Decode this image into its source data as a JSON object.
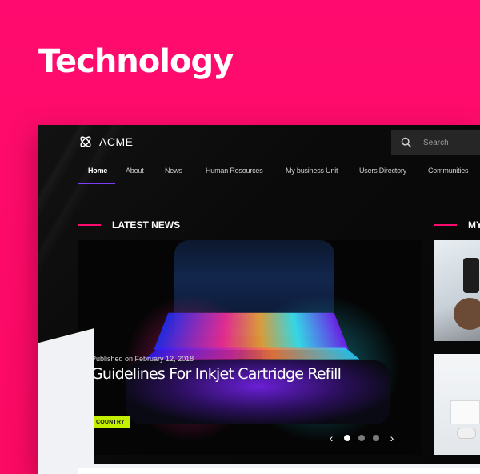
{
  "page": {
    "heading": "Technology"
  },
  "app": {
    "brand": "ACME"
  },
  "search": {
    "placeholder": "Search"
  },
  "nav": {
    "items": [
      {
        "label": "Home"
      },
      {
        "label": "About"
      },
      {
        "label": "News"
      },
      {
        "label": "Human Resources"
      },
      {
        "label": "My business Unit"
      },
      {
        "label": "Users Directory"
      },
      {
        "label": "Communities"
      }
    ],
    "active_index": 0
  },
  "sections": {
    "latest_news": "LATEST NEWS",
    "right_partial": "MY"
  },
  "slider": {
    "published": "Published on February 12, 2018",
    "title": "Guidelines For Inkjet Cartridge Refill",
    "tag": "COUNTRY",
    "prev_icon": "chevron-left-icon",
    "next_icon": "chevron-right-icon",
    "page_count": 3,
    "active_page": 1
  },
  "colors": {
    "background": "#ff0b6f",
    "accent": "#ff0b6f",
    "nav_underline": "#7b3dfd",
    "badge": "#c4f000"
  }
}
